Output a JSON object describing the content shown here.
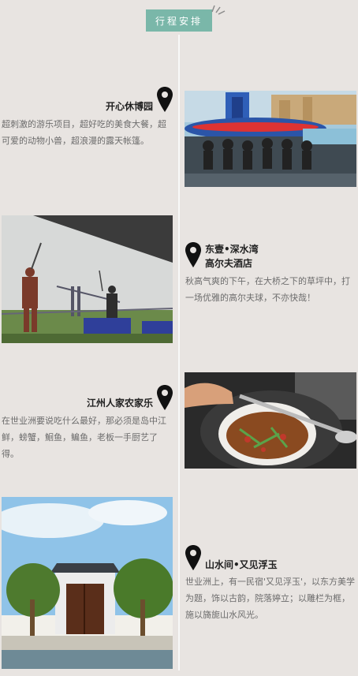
{
  "header": {
    "title": "行程安排"
  },
  "items": [
    {
      "title": "开心休博园",
      "description": "超刺激的游乐项目，超好吃的美食大餐，超可爱的动物小兽，超浪漫的露天帐篷。",
      "icon": "map-pin-icon",
      "photo": "amusement-ride-photo"
    },
    {
      "title_line1": "东壹•深水湾",
      "title_line2": "高尔夫酒店",
      "description": "秋高气爽的下午，在大桥之下的草坪中，打一场优雅的高尔夫球，不亦快哉！",
      "icon": "map-pin-icon",
      "photo": "golf-range-photo"
    },
    {
      "title": "江州人家农家乐",
      "description": "在世业洲要说吃什么最好，那必须是岛中江鲜，螃蟹，鮰鱼，鳊鱼，老板一手厨艺了得。",
      "icon": "map-pin-icon",
      "photo": "wok-cooking-photo"
    },
    {
      "title": "山水间•又见浮玉",
      "description": "世业洲上，有一民宿'又见浮玉'，以东方美学为题，饰以古韵，院落婷立；以雕栏为框，施以旖旎山水风光。",
      "icon": "map-pin-icon",
      "photo": "courtyard-gate-photo"
    }
  ],
  "colors": {
    "accent": "#7ab7a9",
    "background": "#e8e4e1"
  }
}
